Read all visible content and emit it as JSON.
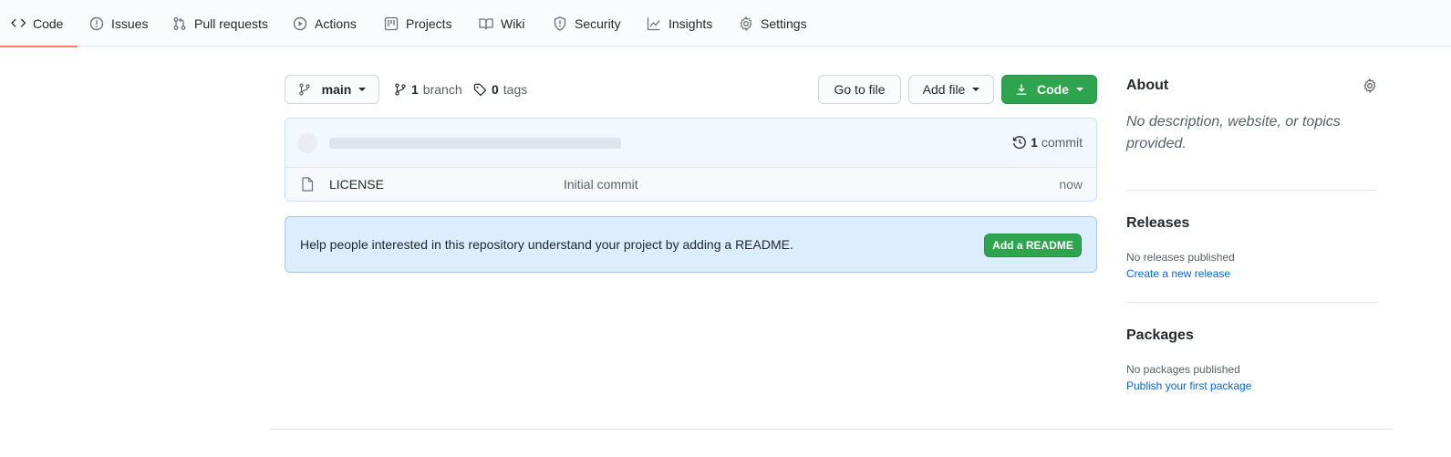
{
  "nav": {
    "tabs": [
      {
        "label": "Code",
        "icon": "code-icon",
        "selected": true
      },
      {
        "label": "Issues",
        "icon": "issue-icon"
      },
      {
        "label": "Pull requests",
        "icon": "pull-request-icon"
      },
      {
        "label": "Actions",
        "icon": "play-icon"
      },
      {
        "label": "Projects",
        "icon": "project-icon"
      },
      {
        "label": "Wiki",
        "icon": "book-icon"
      },
      {
        "label": "Security",
        "icon": "shield-icon"
      },
      {
        "label": "Insights",
        "icon": "graph-icon"
      },
      {
        "label": "Settings",
        "icon": "gear-icon"
      }
    ],
    "accent": "#f9826c"
  },
  "branch_bar": {
    "branch_button": "main",
    "branch_count": "1",
    "branch_label": "branch",
    "tag_count": "0",
    "tag_label": "tags",
    "go_to_file": "Go to file",
    "add_file": "Add file",
    "code": "Code"
  },
  "files": {
    "commit_count": "1",
    "commit_label": "commit",
    "rows": [
      {
        "name": "LICENSE",
        "message": "Initial commit",
        "age": "now"
      }
    ]
  },
  "readme_prompt": {
    "text": "Help people interested in this repository understand your project by adding a README.",
    "button": "Add a README"
  },
  "sidebar": {
    "about_title": "About",
    "about_desc": "No description, website, or topics provided.",
    "releases_title": "Releases",
    "releases_sub": "No releases published",
    "releases_link": "Create a new release",
    "packages_title": "Packages",
    "packages_sub": "No packages published",
    "packages_link": "Publish your first package"
  },
  "colors": {
    "green": "#2ea44f",
    "link": "#0366d6"
  }
}
